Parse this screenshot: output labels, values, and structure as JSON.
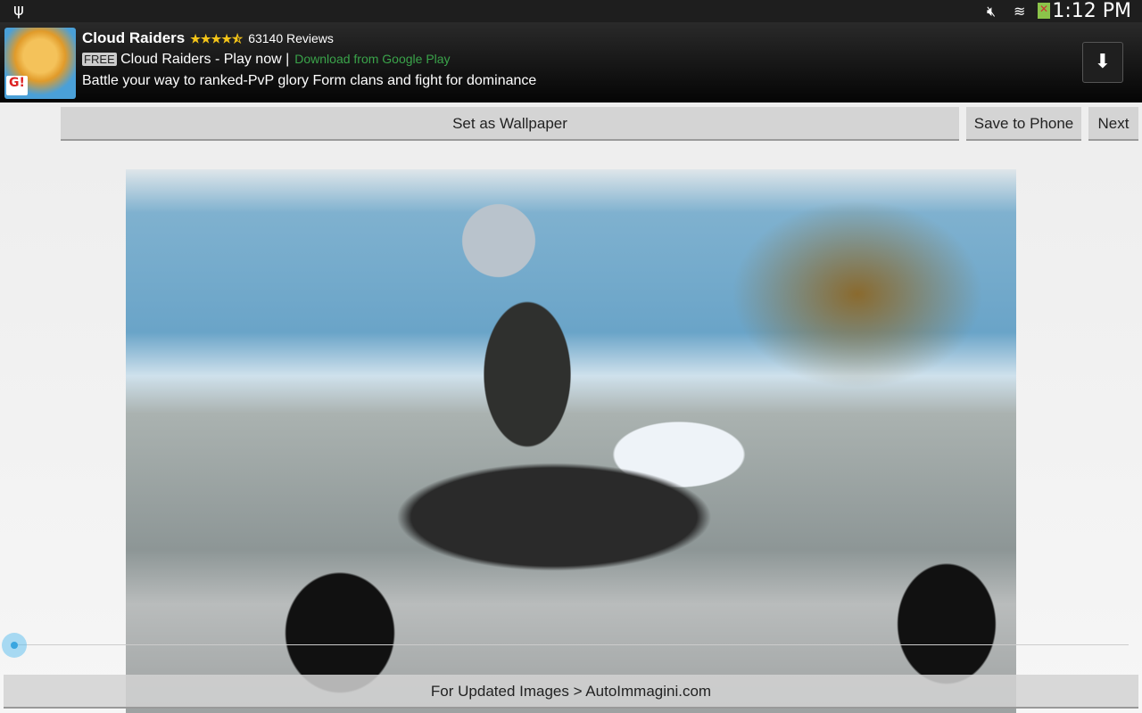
{
  "status_bar": {
    "time": "1:12 PM",
    "icons": [
      "usb-icon",
      "mute-icon",
      "wifi-icon",
      "battery-error-icon"
    ]
  },
  "ad": {
    "title": "Cloud Raiders",
    "rating": "★★★★⯪",
    "reviews": "63140 Reviews",
    "free_badge": "FREE",
    "line2": "Cloud Raiders - Play now |",
    "download_link": "Download from Google Play",
    "description": "Battle your way to ranked-PvP glory Form clans and fight for dominance",
    "badge_text": "G!"
  },
  "toolbar": {
    "set_wallpaper": "Set as Wallpaper",
    "save_to_phone": "Save to Phone",
    "next": "Next"
  },
  "footer": {
    "text": "For Updated Images > AutoImmagini.com"
  },
  "slider": {
    "value": 0
  }
}
